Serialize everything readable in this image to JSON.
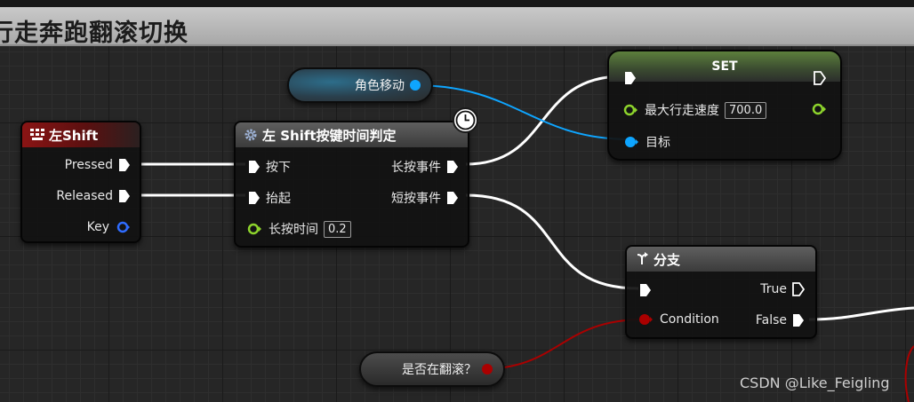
{
  "comment": {
    "title": "行走奔跑翻滚切换"
  },
  "colors": {
    "exec": "#ffffff",
    "float": "#8dd32c",
    "object": "#0ea5ff",
    "bool": "#aa0000",
    "key_pin": "#2f6cff"
  },
  "nodes": {
    "left_shift": {
      "title": "左Shift",
      "icon": "keyboard-icon",
      "pins": {
        "pressed": "Pressed",
        "released": "Released",
        "key": "Key"
      }
    },
    "shift_judge": {
      "title": "左 Shift按键时间判定",
      "icon": "gear-icon",
      "pins": {
        "press": "按下",
        "lift": "抬起",
        "long_press_time": "长按时间",
        "long_press_time_value": "0.2",
        "long_event": "长按事件",
        "short_event": "短按事件"
      }
    },
    "set": {
      "title": "SET",
      "pins": {
        "max_walk_speed": "最大行走速度",
        "max_walk_speed_value": "700.0",
        "target": "目标"
      }
    },
    "branch": {
      "title": "分支",
      "icon": "branch-icon",
      "pins": {
        "condition": "Condition",
        "true": "True",
        "false": "False"
      }
    }
  },
  "variables": {
    "character_movement": "角色移动",
    "is_rolling": "是否在翻滚？"
  },
  "watermark": "CSDN @Like_Feigling"
}
